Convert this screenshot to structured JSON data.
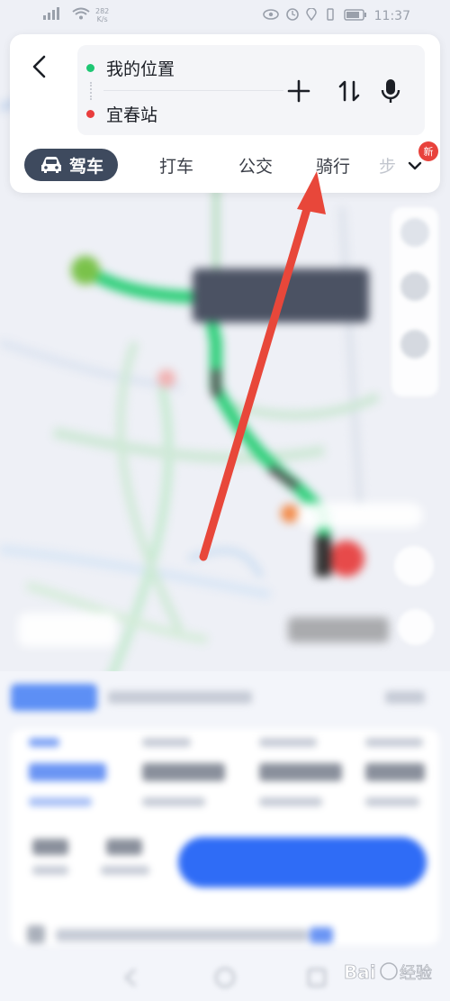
{
  "status_bar": {
    "signal": "46",
    "speed_value": "282",
    "speed_unit": "K/s",
    "time": "11:37"
  },
  "route": {
    "from_label": "我的位置",
    "to_label": "宜春站",
    "tool_icons": [
      "plus-icon",
      "swap-icon",
      "microphone-icon"
    ]
  },
  "tabs": {
    "drive": "驾车",
    "taxi": "打车",
    "bus": "公交",
    "ride": "骑行",
    "walk_partial": "步"
  },
  "badge": {
    "new": "新"
  },
  "colors": {
    "accent_green": "#1ec773",
    "accent_red": "#e93d3d",
    "active_tab": "#3e4a5e",
    "arrow": "#e8473a",
    "primary_blue": "#2f6cf6"
  },
  "watermark": {
    "text": "Bai 经验"
  }
}
